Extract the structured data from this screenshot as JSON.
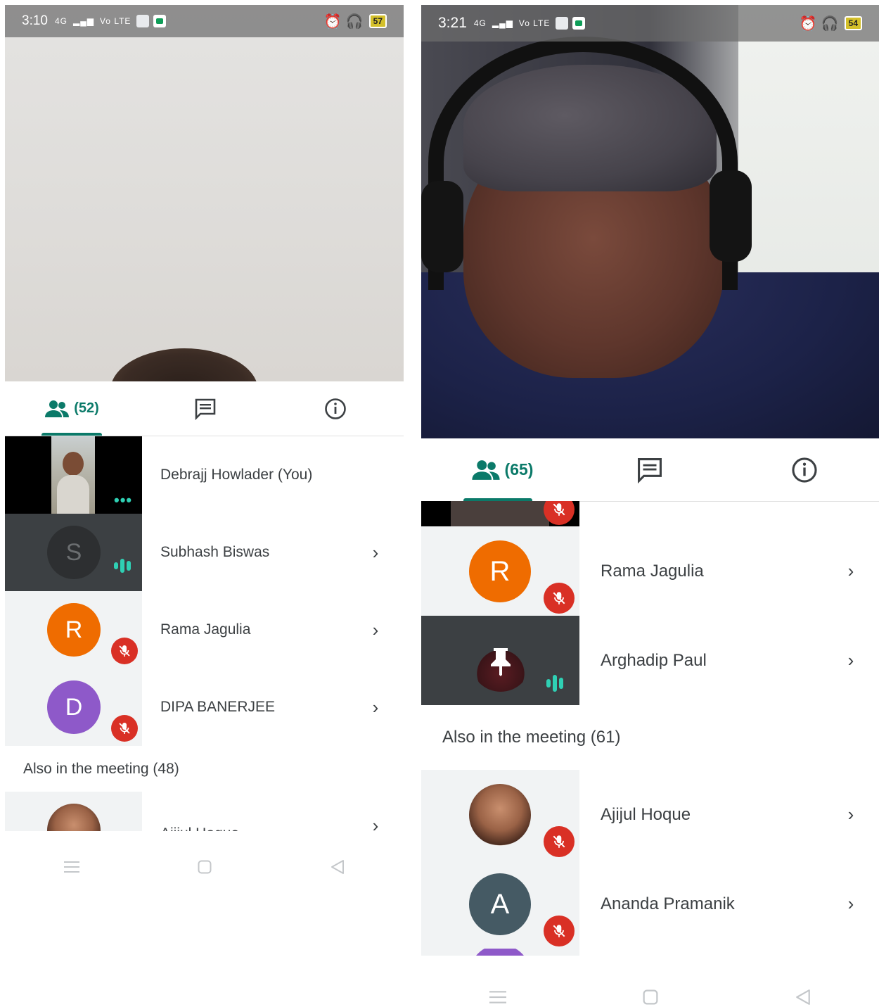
{
  "left": {
    "status": {
      "time": "3:10",
      "network": "4G",
      "volte": "Vo LTE",
      "battery": "57"
    },
    "tabs": {
      "people_count": "(52)"
    },
    "participants": [
      {
        "name": "Debrajj Howlader (You)",
        "kind": "self"
      },
      {
        "name": "Subhash Biswas",
        "initial": "S",
        "kind": "speaking"
      },
      {
        "name": "Rama Jagulia",
        "initial": "R",
        "kind": "muted"
      },
      {
        "name": "DIPA BANERJEE",
        "initial": "D",
        "kind": "muted"
      }
    ],
    "also_header": "Also in the meeting (48)",
    "also": [
      {
        "name": "Ajijul Hoque"
      }
    ]
  },
  "right": {
    "status": {
      "time": "3:21",
      "network": "4G",
      "volte": "Vo LTE",
      "battery": "54"
    },
    "tabs": {
      "people_count": "(65)"
    },
    "participants": [
      {
        "name": "Rama Jagulia",
        "initial": "R",
        "kind": "muted"
      },
      {
        "name": "Arghadip Paul",
        "kind": "speaking"
      }
    ],
    "also_header": "Also in the meeting (61)",
    "also": [
      {
        "name": "Ajijul Hoque",
        "kind": "muted"
      },
      {
        "name": "Ananda Pramanik",
        "initial": "A",
        "kind": "muted"
      }
    ]
  },
  "icons": {
    "people": "people-icon",
    "chat": "chat-icon",
    "info": "info-icon",
    "chevron": "chevron-right-icon",
    "mic_off": "mic-off-icon"
  },
  "colors": {
    "accent": "#0b7a69",
    "muted": "#d93025",
    "speaking": "#2fd0b4",
    "avatar_orange": "#ef6c00",
    "avatar_purple": "#8e59c9",
    "avatar_slate": "#455a64"
  }
}
